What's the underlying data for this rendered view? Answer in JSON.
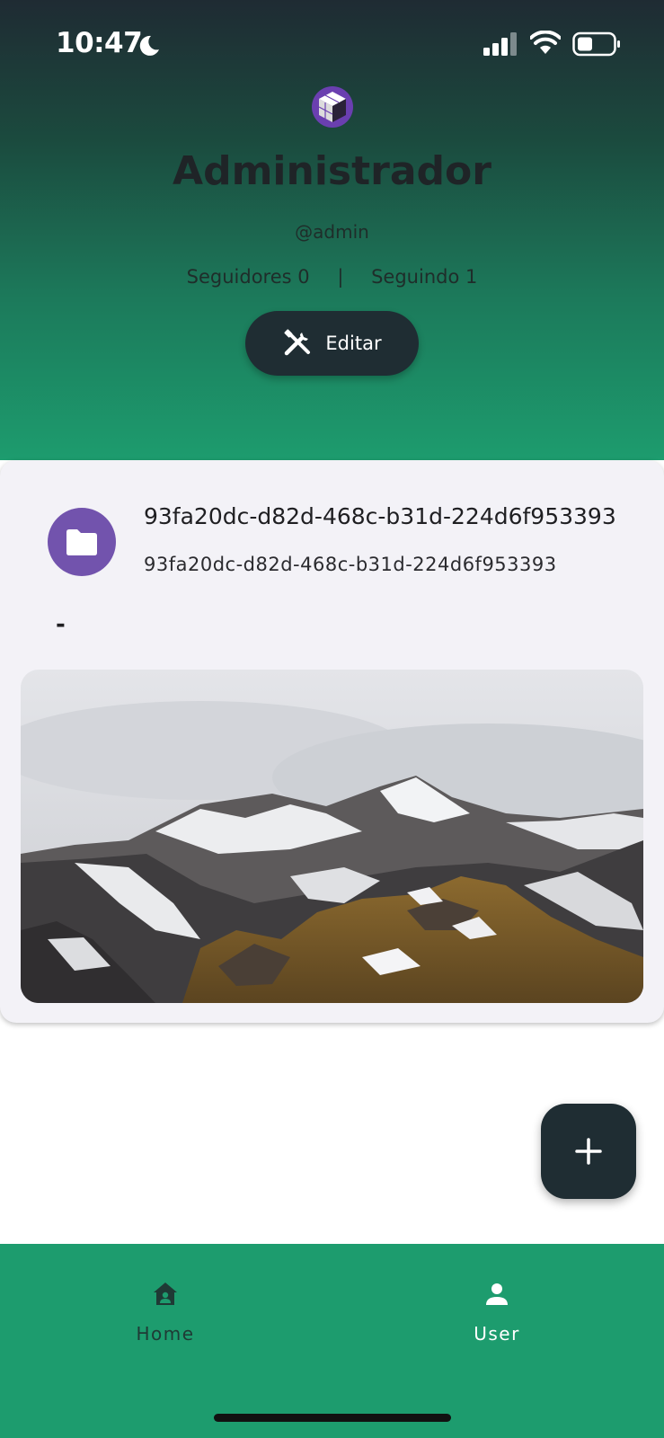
{
  "status_bar": {
    "time": "10:47",
    "icons": [
      "moon-icon",
      "cellular-signal-icon",
      "wifi-icon",
      "battery-icon"
    ]
  },
  "profile": {
    "logo_icon": "cube-logo-icon",
    "name": "Administrador",
    "handle": "@admin",
    "followers_label": "Seguidores 0",
    "separator": "|",
    "following_label": "Seguindo 1",
    "edit_button_label": "Editar",
    "edit_icon": "tools-icon"
  },
  "card": {
    "avatar_icon": "folder-icon",
    "title": "93fa20dc-d82d-468c-b31d-224d6f953393",
    "subtitle": "93fa20dc-d82d-468c-b31d-224d6f953393",
    "description": "-",
    "image_subject": "snowy-mountains-image"
  },
  "fab": {
    "icon": "plus-icon"
  },
  "bottom_nav": {
    "items": [
      {
        "label": "Home",
        "icon": "home-icon",
        "active": false
      },
      {
        "label": "User",
        "icon": "user-icon",
        "active": true
      }
    ]
  },
  "colors": {
    "header_top": "#1f2b33",
    "header_bottom": "#1d9c6e",
    "accent_green": "#1d9c6e",
    "dark_button": "#1f2d33",
    "avatar_purple": "#7253ad",
    "card_bg": "#f3f2f7"
  }
}
